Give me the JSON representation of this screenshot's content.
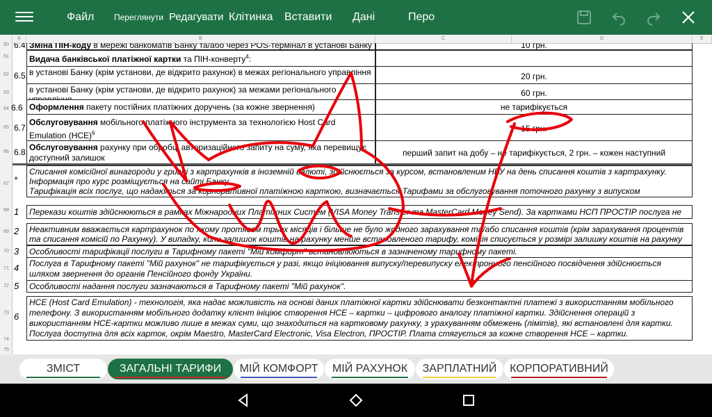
{
  "toolbar": {
    "menu_icon": "hamburger-icon",
    "items": [
      "Файл",
      "Переглянути",
      "Редагувати",
      "Клітинка",
      "Вставити",
      "Дані",
      "Перо"
    ],
    "icons": [
      "save-icon",
      "undo-icon",
      "redo-icon",
      "close-icon"
    ],
    "colors": {
      "background": "#1e7145",
      "text": "#ffffff"
    }
  },
  "columns": [
    "A",
    "B",
    "C",
    "D",
    "E"
  ],
  "row_numbers": [
    "60",
    "61",
    "62",
    "63",
    "64",
    "65",
    "66",
    "67",
    "68",
    "69",
    "70",
    "71",
    "72",
    "73",
    "74",
    "75"
  ],
  "rows": {
    "r60": {
      "num": "6.4.",
      "desc_bold": "Зміна ПІН-коду",
      "desc": " в мережі банкоматів Банку та/або через POS-термінал в установі Банку",
      "value": "10 грн."
    },
    "r61": {
      "desc_bold": "Видача банківської платіжної картки",
      "desc": " та ПІН-конверту",
      "sup": "4",
      ":": ":"
    },
    "r62": {
      "num": "6.5.",
      "desc": "в установі Банку (крім установи, де відкрито рахунок) в межах регіонального управління",
      "value": "20 грн."
    },
    "r63": {
      "desc": "в установі Банку (крім установи, де відкрито рахунок) за межами регіонального управління",
      "value": "60 грн."
    },
    "r64": {
      "num": "6.6",
      "desc_bold": "Оформлення",
      "desc": " пакету постійних платіжних доручень (за кожне звернення)",
      "value": "не тарифікується"
    },
    "r65": {
      "num": "6.7.",
      "desc_bold": "Обслуговування",
      "desc": " мобільного платіжного інструмента  за технологією Host Card Emulation (HCE)",
      "sup": "6",
      "value": "15 грн."
    },
    "r66": {
      "num": "6.8.",
      "desc_bold": "Обслуговування",
      "desc": " рахунку при обробці авторизаційного запиту на суму, яка перевищує доступний залишок",
      "value": "перший запит на добу – не тарифікується, 2 грн. – кожен наступний"
    }
  },
  "footnotes": [
    {
      "mark": "*",
      "text": "Списання комісійної винагороди у гривні з картрахунків в іноземній валюті, здійснюється за курсом, встановленим  НБУ на день списання коштів з картрахунку. Інформація про курс розміщується на сайті Банку.",
      "text2": "Тарифікація всіх послуг, що надаються за корпоративної платіжною карткою, визначається Тарифами за обслуговування поточного рахунку з випуском корпоративної платіжної картки."
    },
    {
      "mark": "1",
      "text": "Перекази коштів здійснюються в рамках Міжнародних Платіжних Систем (VISA Money Transfer та MasterCard Money Send). За картками НСП ПРОСТІР послуга не надається."
    },
    {
      "mark": "2",
      "text": "Неактивним вважається картрахунок по якому протягом трьох місяців і більше не було жодного зарахування та/або списання коштів (крім зарахування процентів та списання комісій по Рахунку). У випадку, коли залишок коштів на рахунку менше встановленого тарифу, комісія списується у розмірі залишку коштів на рахунку"
    },
    {
      "mark": "3",
      "text": "Особливості тарифікації послуги в Тарифному пакеті \"Мій комфорт\" встановлюються в зазначеному тарифному пакеті."
    },
    {
      "mark": "4",
      "text": "Послуга в Тарифному пакеті \"Мій рахунок\" не тарифікується у разі, якщо ініціювання випуску/перевипуску електронного пенсійного посвідчення здійснюється шляхом звернення до органів Пенсійного фонду України."
    },
    {
      "mark": "5",
      "text": "Особливості надання послуги зазначаються в Тарифному пакеті \"Мій рахунок\"."
    },
    {
      "mark": "6",
      "text": "HCE (Host Card Emulation) - технологія, яка надає можливість на основі даних платіжної картки здійснювати безконтактні платежі з використанням мобільного телефону. З використанням мобільного додатку клієнт ініціює створення НСЕ – картки – цифрового аналогу платіжної картки. Здійснення операцій з використанням НСЕ-картки можливо лише в межах суми, що знаходиться на картковому рахунку, з урахуванням обмежень (лімітів), які встановлені для картки. Послуга доступна для всіх карток, окрім Maestro, MasterCard Electronic, Visa Electron, ПРОСТІР. Плата стягується за кожне створення НСЕ – картки."
    }
  ],
  "tabs": [
    {
      "label": "ЗМІСТ",
      "underline": "#1e7145"
    },
    {
      "label": "ЗАГАЛЬНІ ТАРИФИ",
      "underline": "#c62828",
      "active": true
    },
    {
      "label": "МІЙ КОМФОРТ",
      "underline": "#3f51b5"
    },
    {
      "label": "МІЙ РАХУНОК",
      "underline": "#1e7145"
    },
    {
      "label": "ЗАРПЛАТНИЙ",
      "underline": "#f4d03f"
    },
    {
      "label": "КОРПОРАТИВНИЙ",
      "underline": "#b71c1c"
    }
  ],
  "navbar": {
    "icons": [
      "back-icon",
      "home-icon",
      "recents-icon"
    ]
  },
  "ink_color": "#e8000b"
}
